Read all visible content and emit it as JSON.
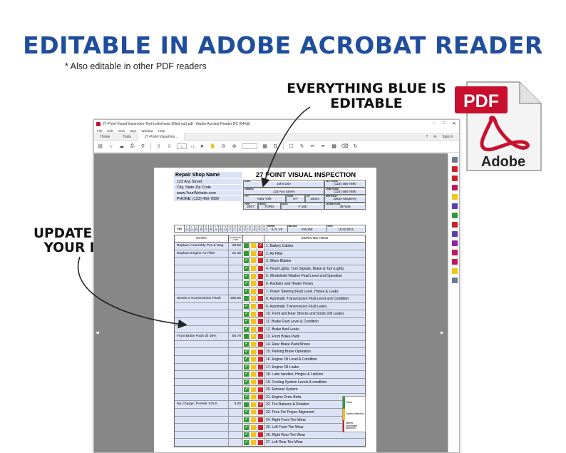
{
  "promo": {
    "headline": "EDITABLE IN ADOBE ACROBAT READER",
    "subline": "* Also editable in other PDF readers",
    "callout_blue": "EVERYTHING BLUE IS EDITABLE",
    "callout_update": "UPDATE WITH YOUR INFO",
    "pdf_logo_text": "PDF",
    "adobe_text": "Adobe"
  },
  "window": {
    "title": "27-Point-Visual-Inspection-Tent-Letterhead (filled out).pdf - Adobe Acrobat Reader DC (64-bit)",
    "menu": [
      "File",
      "Edit",
      "View",
      "Sign",
      "Window",
      "Help"
    ],
    "tabs": {
      "home": "Home",
      "tools": "Tools",
      "doc": "27-Point-Visual-Ins..."
    },
    "signin": "Sign In",
    "page_current": "1",
    "page_total": "/ 1"
  },
  "shop": {
    "name": "Repair Shop Name",
    "lines": [
      "123 Any Street",
      "City, State Zip Code",
      "www.YourWebsite.com",
      "PHONE: (123) 456-7890"
    ]
  },
  "doc_title": "27 POINT VISUAL INSPECTION",
  "header_fields": {
    "row1": [
      {
        "label": "NAME:",
        "value": "John Doe"
      },
      {
        "label": "CELL PHONE:",
        "value": "(123) 456-7890"
      }
    ],
    "row2": [
      {
        "label": "ADDRESS:",
        "value": "123 Any Street"
      },
      {
        "label": "HOME PHONE:",
        "value": "(123) 456-7890"
      }
    ],
    "row3": [
      {
        "label": "CITY:",
        "value": "New York"
      },
      {
        "label": "STATE:",
        "value": "NY"
      },
      {
        "label": "ZIP:",
        "value": "10044"
      },
      {
        "label": "WRITTEN BY:",
        "value": "Jason Mayberry"
      }
    ],
    "row4": [
      {
        "label": "YEAR:",
        "value": "2007"
      },
      {
        "label": "MODEL:",
        "value": "FORD"
      },
      {
        "label": "MAKE:",
        "value": "F-150"
      },
      {
        "label": "LICENSE PLATE:",
        "value": "397644"
      }
    ]
  },
  "vin": {
    "label": "VIN",
    "chars": [
      "4",
      "U",
      "H",
      "R",
      "T",
      "R",
      "4",
      "5",
      "U",
      "I",
      "L",
      "6",
      "3",
      "2",
      "8",
      "9",
      "6"
    ],
    "motor_label": "MOTOR:",
    "motor": "5.7L V8",
    "mileage_label": "MILEAGE:",
    "mileage": "236,368",
    "date_label": "DATE:",
    "date": "11/21/2021"
  },
  "inspection": {
    "headers": {
      "notes": "NOTES",
      "cost": "ESTIMATED COST",
      "items": "INSPECTED ITEMS"
    },
    "rows": [
      {
        "note": "Replace Assembly Pos & Neg.",
        "cost": "28.50",
        "status": "r",
        "item": "1. Battery Cables"
      },
      {
        "note": "Replace Engine Air Filter",
        "cost": "21.45",
        "status": "r",
        "item": "2. Air Filter"
      },
      {
        "note": "",
        "cost": "",
        "status": "g",
        "item": "3. Wiper Blades"
      },
      {
        "note": "",
        "cost": "",
        "status": "g",
        "item": "4. Head Lights, Turn Signals, Brake & Turn Lights"
      },
      {
        "note": "",
        "cost": "",
        "status": "g",
        "item": "5. Windshield Washer Fluid Level and Operation"
      },
      {
        "note": "",
        "cost": "",
        "status": "g",
        "item": "6. Radiator and Heater Hoses"
      },
      {
        "note": "",
        "cost": "",
        "status": "g",
        "item": "7. Power Steering Fluid Level, Hoses & Leaks"
      },
      {
        "note": "Needs a Transmission Flush",
        "cost": "189.85",
        "status": "y",
        "item": "8. Automatic Transmission Fluid Level and Condition"
      },
      {
        "note": "",
        "cost": "",
        "status": "g",
        "item": "9. Automatic Transmission Fluid Leaks"
      },
      {
        "note": "",
        "cost": "",
        "status": "g",
        "item": "10. Front and Rear Shocks and Struts (Oil Leaks)"
      },
      {
        "note": "",
        "cost": "",
        "status": "g",
        "item": "11. Brake Fluid Level & Condition"
      },
      {
        "note": "",
        "cost": "",
        "status": "g",
        "item": "12. Brake fluid Leaks"
      },
      {
        "note": "Front Brake Pads @ 35%",
        "cost": "56.78",
        "status": "y",
        "item": "13. Front Brake Pads"
      },
      {
        "note": "",
        "cost": "",
        "status": "g",
        "item": "14. Rear Brake Pads/Shoes"
      },
      {
        "note": "",
        "cost": "",
        "status": "g",
        "item": "15. Parking Brake Operation"
      },
      {
        "note": "",
        "cost": "",
        "status": "g",
        "item": "16. Engine Oil Level & Condition"
      },
      {
        "note": "",
        "cost": "",
        "status": "g",
        "item": "17. Engine Oil Leaks"
      },
      {
        "note": "",
        "cost": "",
        "status": "g",
        "item": "18. Lube handles, Hinges & Latches"
      },
      {
        "note": "",
        "cost": "",
        "status": "g",
        "item": "19. Cooling System Levels & condition"
      },
      {
        "note": "",
        "cost": "",
        "status": "g",
        "item": "20. Exhaust System"
      },
      {
        "note": "",
        "cost": "",
        "status": "g",
        "item": "21. Engine Drive Belts"
      },
      {
        "note": "No Charge, THANK YOU!",
        "cost": "0.00",
        "status": "r",
        "item": "22. Tire Balance & Rotation"
      },
      {
        "note": "",
        "cost": "",
        "status": "g",
        "item": "23. Tires For Proper Alignment"
      },
      {
        "note": "",
        "cost": "",
        "status": "g",
        "item": "24. Right Front Tire Wear"
      },
      {
        "note": "",
        "cost": "",
        "status": "g",
        "item": "25. Left Front Tire Wear"
      },
      {
        "note": "",
        "cost": "",
        "status": "g",
        "item": "26. Right Rear Tire Wear"
      },
      {
        "note": "",
        "cost": "",
        "status": "g",
        "item": "27. Left Rear Tire Wear"
      }
    ]
  },
  "legend": [
    {
      "color": "#2e9a3a",
      "label": "Pass"
    },
    {
      "color": "#f3c41a",
      "label": "Needs Attention"
    },
    {
      "color": "#d0202a",
      "label": "Needs Immediate Attention"
    }
  ],
  "colors": {
    "headline": "#1f4e9c",
    "editable": "#dce3f6",
    "adobe_red": "#c8102e"
  }
}
